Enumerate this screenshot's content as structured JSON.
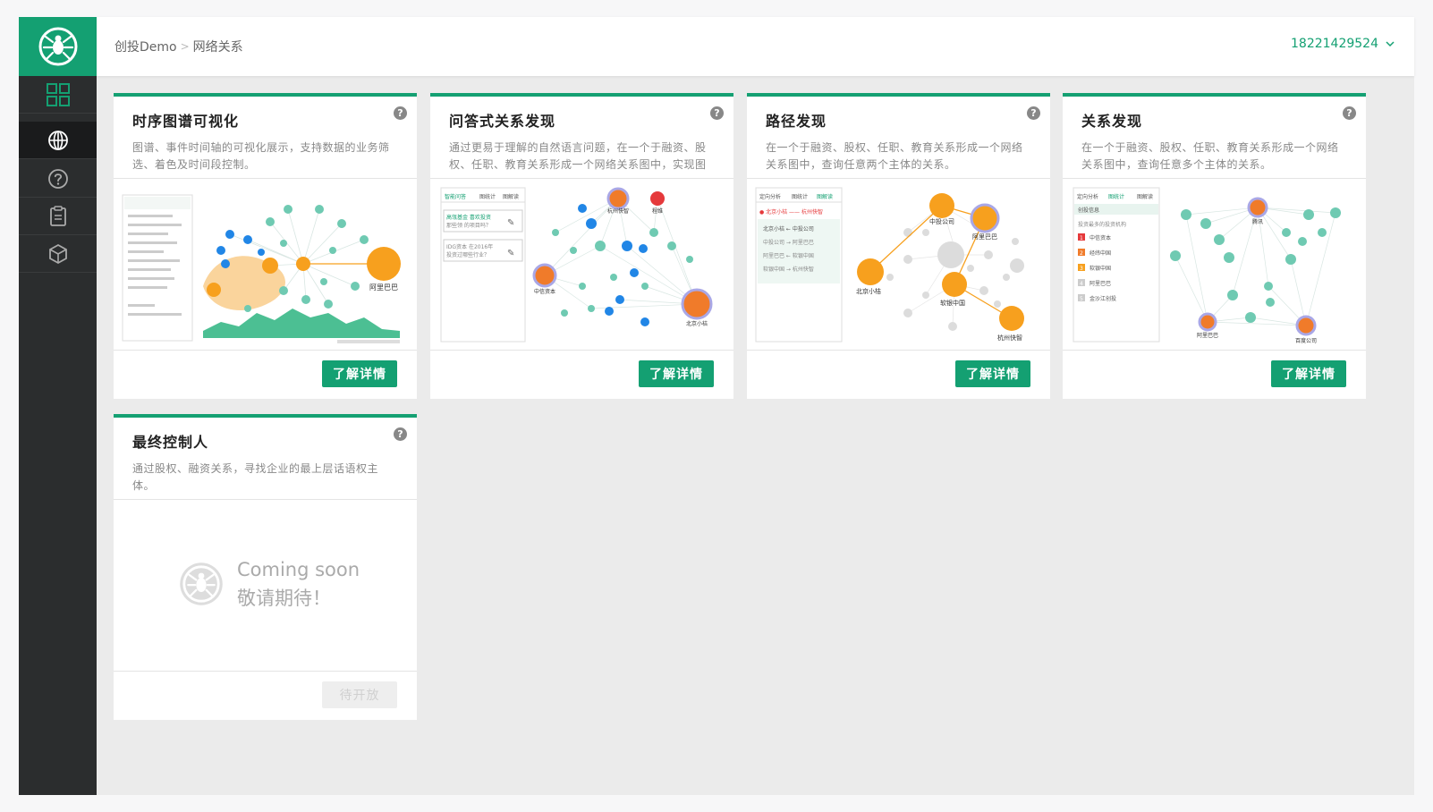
{
  "header": {
    "breadcrumb": [
      "创投Demo",
      "网络关系"
    ],
    "breadcrumb_sep": ">",
    "user": "18221429524"
  },
  "sidebar": {
    "items": [
      {
        "icon": "grid-icon",
        "active": false
      },
      {
        "icon": "globe-icon",
        "active": true
      },
      {
        "icon": "question-icon",
        "active": false
      },
      {
        "icon": "clipboard-icon",
        "active": false
      },
      {
        "icon": "cube-icon",
        "active": false
      }
    ]
  },
  "cards": [
    {
      "title": "时序图谱可视化",
      "desc": "图谱、事件时间轴的可视化展示，支持数据的业务筛选、着色及时间段控制。",
      "button": "了解详情",
      "help": "?"
    },
    {
      "title": "问答式关系发现",
      "desc": "通过更易于理解的自然语言问题，在一个于融资、股权、任职、教育关系形成一个网络关系图中，实现图",
      "button": "了解详情",
      "help": "?"
    },
    {
      "title": "路径发现",
      "desc": "在一个于融资、股权、任职、教育关系形成一个网络关系图中，查询任意两个主体的关系。",
      "button": "了解详情",
      "help": "?"
    },
    {
      "title": "关系发现",
      "desc": "在一个于融资、股权、任职、教育关系形成一个网络关系图中，查询任意多个主体的关系。",
      "button": "了解详情",
      "help": "?"
    },
    {
      "title": "最终控制人",
      "desc": "通过股权、融资关系，寻找企业的最上层话语权主体。",
      "button": "待开放",
      "help": "?",
      "coming_soon": "Coming soon",
      "coming_soon_cn": "敬请期待！"
    }
  ],
  "previews": {
    "timeline": {
      "node_label": "阿里巴巴"
    },
    "qa": {
      "tabs": [
        "智能问答",
        "图统计",
        "图解读"
      ],
      "q1a": "高瓴基金 喜欢投资",
      "q1b": "那些领 的项目吗？",
      "q2a": "IDG资本 在2016年",
      "q2b": "投资过哪些行业？",
      "labels": [
        "杭州快智",
        "程维",
        "中信资本",
        "北京小桔"
      ]
    },
    "path": {
      "tabs": [
        "定向分析",
        "图统计",
        "图解读"
      ],
      "head": "● 北京小桔 —— 杭州快智",
      "rows": [
        "北京小桔 ← 中投公司",
        "中投公司 → 阿里巴巴",
        "阿里巴巴 ← 软银中国",
        "软银中国 → 杭州快智"
      ],
      "labels": [
        "中投公司",
        "阿里巴巴",
        "北京小桔",
        "软银中国",
        "杭州快智"
      ]
    },
    "relation": {
      "tabs": [
        "定向分析",
        "图统计",
        "图解读"
      ],
      "section": "创投信息",
      "list_title": "投资最多的投资机构",
      "list": [
        "中信资本",
        "经纬中国",
        "软银中国",
        "阿里巴巴",
        "金沙江创投"
      ],
      "rank": [
        "1",
        "2",
        "3",
        "4",
        "5"
      ],
      "labels": [
        "腾讯",
        "阿里巴巴",
        "百度公司"
      ]
    }
  },
  "colors": {
    "accent": "#14a072",
    "sidebar": "#2b2d2e",
    "orange": "#f7a01e",
    "teal": "#6fcab2",
    "blue": "#2186e6"
  }
}
